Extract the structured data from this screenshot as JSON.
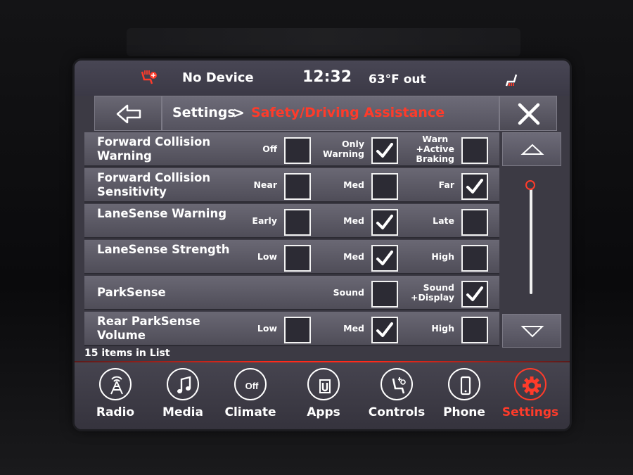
{
  "status": {
    "device": "No Device",
    "time": "12:32",
    "temperature": "63°F out",
    "icons": [
      "heated-seat-left-icon",
      "heated-seat-right-icon"
    ]
  },
  "header": {
    "root": "Settings",
    "separator": ">",
    "current": "Safety/Driving Assistance",
    "back_icon": "back-arrow-icon",
    "close_icon": "close-icon"
  },
  "rows": [
    {
      "label": "Forward Collision Warning",
      "options": [
        {
          "text": "Off",
          "checked": false
        },
        {
          "text": "Only Warning",
          "checked": true
        },
        {
          "text": "Warn +Active Braking",
          "checked": false
        }
      ]
    },
    {
      "label": "Forward Collision Sensitivity",
      "options": [
        {
          "text": "Near",
          "checked": false
        },
        {
          "text": "Med",
          "checked": false
        },
        {
          "text": "Far",
          "checked": true
        }
      ]
    },
    {
      "label": "LaneSense Warning",
      "options": [
        {
          "text": "Early",
          "checked": false
        },
        {
          "text": "Med",
          "checked": true
        },
        {
          "text": "Late",
          "checked": false
        }
      ]
    },
    {
      "label": "LaneSense Strength",
      "options": [
        {
          "text": "Low",
          "checked": false
        },
        {
          "text": "Med",
          "checked": true
        },
        {
          "text": "High",
          "checked": false
        }
      ]
    },
    {
      "label": "ParkSense",
      "options": [
        {
          "text": "Sound",
          "checked": false
        },
        {
          "text": "Sound +Display",
          "checked": true
        }
      ]
    },
    {
      "label": "Rear ParkSense Volume",
      "options": [
        {
          "text": "Low",
          "checked": false
        },
        {
          "text": "Med",
          "checked": true
        },
        {
          "text": "High",
          "checked": false
        }
      ]
    }
  ],
  "list_count": "15 items in List",
  "nav": [
    {
      "label": "Radio",
      "icon": "radio-tower-icon",
      "active": false
    },
    {
      "label": "Media",
      "icon": "music-note-icon",
      "active": false
    },
    {
      "label": "Climate",
      "icon": "climate-off-icon",
      "icon_text": "Off",
      "active": false
    },
    {
      "label": "Apps",
      "icon": "apps-icon",
      "active": false
    },
    {
      "label": "Controls",
      "icon": "controls-seat-icon",
      "active": false
    },
    {
      "label": "Phone",
      "icon": "phone-icon",
      "active": false
    },
    {
      "label": "Settings",
      "icon": "gear-icon",
      "active": true
    }
  ],
  "colors": {
    "accent": "#ff3b2a",
    "panel": "#5c5a66",
    "text": "#ffffff"
  }
}
